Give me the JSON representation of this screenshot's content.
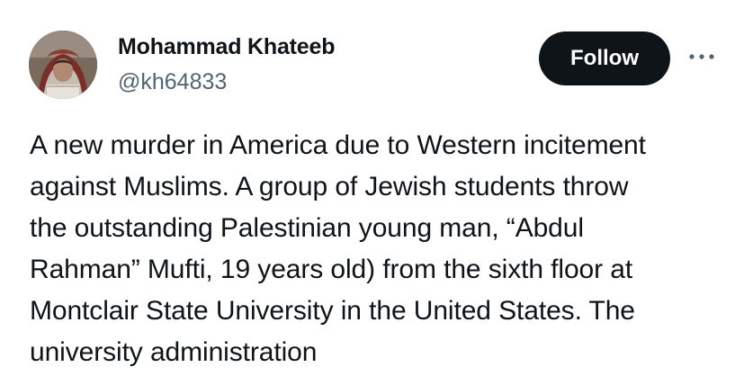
{
  "author": {
    "name": "Mohammad Khateeb",
    "handle": "@kh64833",
    "avatar_icon": "profile-photo"
  },
  "actions": {
    "follow_label": "Follow",
    "more_icon": "more-horizontal-icon"
  },
  "tweet": {
    "lines": [
      "A new murder in America due to Western incitement",
      "against Muslims. A group of Jewish students throw",
      "the outstanding Palestinian young man, “Abdul",
      "Rahman” Mufti, 19 years old) from the sixth floor at",
      "Montclair State University in the United States. The",
      "university administration"
    ]
  },
  "colors": {
    "text": "#0f1419",
    "secondary": "#536471",
    "button_bg": "#0f1419",
    "button_text": "#ffffff"
  }
}
